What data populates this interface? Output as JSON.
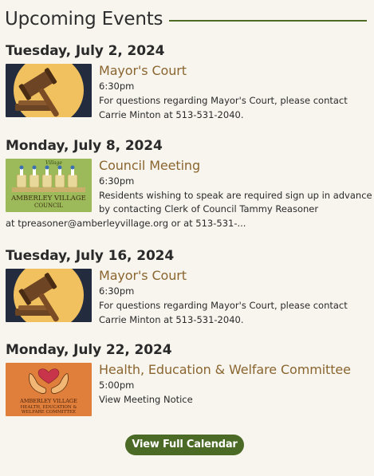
{
  "section": {
    "title": "Upcoming Events",
    "accent_color": "#4d6b24"
  },
  "events": [
    {
      "date": "Tuesday, July 2, 2024",
      "title": "Mayor's Court",
      "time": "6:30pm",
      "description": "For questions regarding Mayor's Court, please contact Carrie Minton at 513-531-2040.",
      "image": "gavel-icon"
    },
    {
      "date": "Monday, July 8, 2024",
      "title": "Council Meeting",
      "time": "6:30pm",
      "description_line1": "Residents wishing to speak are required sign up in advance",
      "description_line2": "by contacting Clerk of Council Tammy Reasoner",
      "description_line3": "at tpreasoner@amberleyvillage.org or at 513-531-...",
      "image": "council-chairs-image",
      "image_text_top": "Village",
      "image_text_1": "AMBERLEY VILLAGE",
      "image_text_2": "COUNCIL"
    },
    {
      "date": "Tuesday, July 16, 2024",
      "title": "Mayor's Court",
      "time": "6:30pm",
      "description": "For questions regarding Mayor's Court, please contact Carrie Minton at 513-531-2040.",
      "image": "gavel-icon"
    },
    {
      "date": "Monday, July 22, 2024",
      "title": "Health, Education & Welfare Committee",
      "time": "5:00pm",
      "description": "View Meeting Notice",
      "image": "hands-heart-image",
      "image_text_1": "AMBERLEY VILLAGE",
      "image_text_2": "HEALTH, EDUCATION &",
      "image_text_3": "WELFARE COMMITTEE"
    }
  ],
  "button": {
    "label": "View Full Calendar",
    "color": "#4a6a25"
  }
}
